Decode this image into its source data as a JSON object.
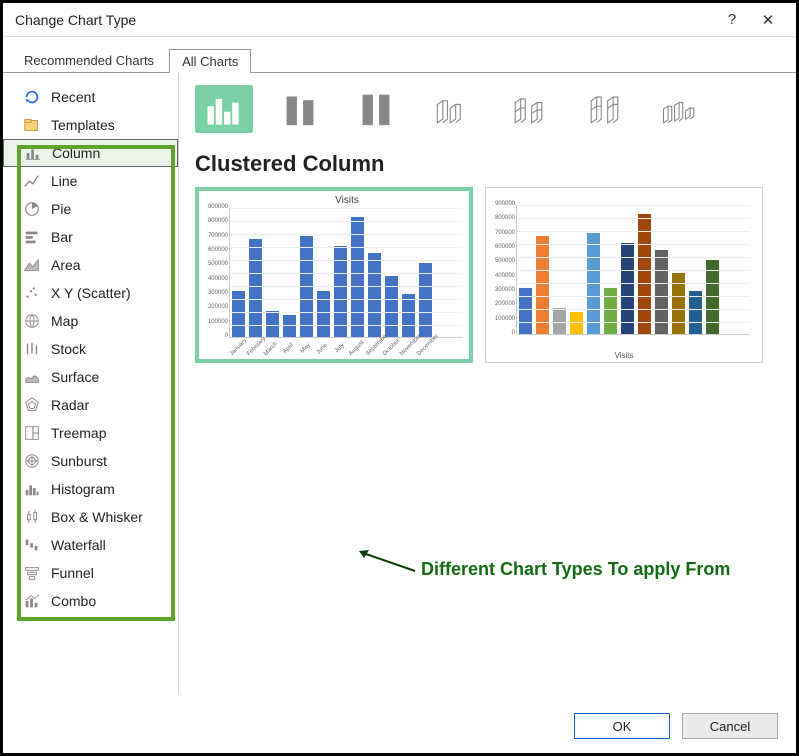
{
  "dialog": {
    "title": "Change Chart Type",
    "help_icon": "?",
    "close_icon": "✕"
  },
  "tabs": {
    "recommended": "Recommended Charts",
    "all": "All Charts"
  },
  "sidebar": {
    "items": [
      {
        "key": "recent",
        "label": "Recent"
      },
      {
        "key": "templates",
        "label": "Templates"
      },
      {
        "key": "column",
        "label": "Column"
      },
      {
        "key": "line",
        "label": "Line"
      },
      {
        "key": "pie",
        "label": "Pie"
      },
      {
        "key": "bar",
        "label": "Bar"
      },
      {
        "key": "area",
        "label": "Area"
      },
      {
        "key": "scatter",
        "label": "X Y (Scatter)"
      },
      {
        "key": "map",
        "label": "Map"
      },
      {
        "key": "stock",
        "label": "Stock"
      },
      {
        "key": "surface",
        "label": "Surface"
      },
      {
        "key": "radar",
        "label": "Radar"
      },
      {
        "key": "treemap",
        "label": "Treemap"
      },
      {
        "key": "sunburst",
        "label": "Sunburst"
      },
      {
        "key": "histogram",
        "label": "Histogram"
      },
      {
        "key": "boxwhisker",
        "label": "Box & Whisker"
      },
      {
        "key": "waterfall",
        "label": "Waterfall"
      },
      {
        "key": "funnel",
        "label": "Funnel"
      },
      {
        "key": "combo",
        "label": "Combo"
      }
    ],
    "selected": "column"
  },
  "subtypes": {
    "names": [
      "clustered-column",
      "stacked-column",
      "stacked100-column",
      "3d-clustered-column",
      "3d-stacked-column",
      "3d-stacked100-column",
      "3d-column"
    ],
    "selected": "clustered-column"
  },
  "main": {
    "heading": "Clustered Column",
    "preview1_title": "Visits",
    "preview2_xcaption": "Visits"
  },
  "annotation": {
    "text": "Different Chart Types To apply From"
  },
  "footer": {
    "ok": "OK",
    "cancel": "Cancel"
  },
  "chart_data": {
    "type": "bar",
    "title": "Visits",
    "ylabel": "",
    "ylim": [
      0,
      900000
    ],
    "yticks": [
      0,
      100000,
      200000,
      300000,
      400000,
      500000,
      600000,
      700000,
      800000,
      900000
    ],
    "categories": [
      "January",
      "February",
      "March",
      "April",
      "May",
      "June",
      "July",
      "August",
      "September",
      "October",
      "November",
      "December"
    ],
    "values": [
      320000,
      680000,
      180000,
      150000,
      700000,
      320000,
      630000,
      830000,
      580000,
      420000,
      300000,
      510000
    ]
  }
}
